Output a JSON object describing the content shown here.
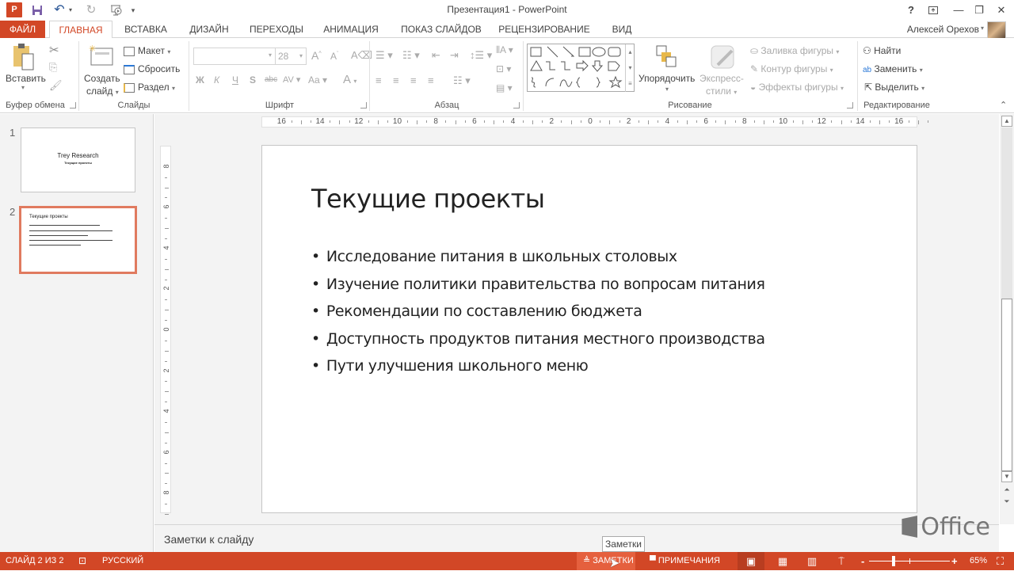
{
  "titlebar": {
    "app_logo": "P",
    "title": "Презентация1 - PowerPoint",
    "quick_access": [
      "save-icon",
      "undo-icon",
      "redo-icon",
      "start-slideshow-icon",
      "customize-qat-icon"
    ],
    "window_buttons": {
      "help": "?",
      "ribbon_display": "⊼",
      "minimize": "—",
      "restore": "❐",
      "close": "✕"
    }
  },
  "tabs": [
    {
      "label": "ФАЙЛ"
    },
    {
      "label": "ГЛАВНАЯ",
      "active": true
    },
    {
      "label": "ВСТАВКА"
    },
    {
      "label": "ДИЗАЙН"
    },
    {
      "label": "ПЕРЕХОДЫ"
    },
    {
      "label": "АНИМАЦИЯ"
    },
    {
      "label": "ПОКАЗ СЛАЙДОВ"
    },
    {
      "label": "РЕЦЕНЗИРОВАНИЕ"
    },
    {
      "label": "ВИД"
    }
  ],
  "user": {
    "name": "Алексей Орехов"
  },
  "ribbon": {
    "clipboard": {
      "label": "Буфер обмена",
      "paste": "Вставить"
    },
    "slides": {
      "label": "Слайды",
      "new_slide_1": "Создать",
      "new_slide_2": "слайд",
      "layout": "Макет",
      "reset": "Сбросить",
      "section": "Раздел"
    },
    "font": {
      "label": "Шрифт",
      "font_name": "",
      "font_size": "28",
      "bold": "Ж",
      "italic": "К",
      "underline": "Ч",
      "shadow": "S",
      "strike": "abc",
      "spacing": "AV",
      "case": "Aa",
      "color": "A"
    },
    "paragraph": {
      "label": "Абзац"
    },
    "drawing": {
      "label": "Рисование",
      "arrange": "Упорядочить",
      "quick_styles_1": "Экспресс-",
      "quick_styles_2": "стили",
      "shape_fill": "Заливка фигуры",
      "shape_outline": "Контур фигуры",
      "shape_effects": "Эффекты фигуры"
    },
    "editing": {
      "label": "Редактирование",
      "find": "Найти",
      "replace": "Заменить",
      "select": "Выделить"
    }
  },
  "thumbnails": [
    {
      "number": "1",
      "title": "Trey Research",
      "subtitle": "Текущие проекты"
    },
    {
      "number": "2",
      "title": "Текущие проекты",
      "selected": true
    }
  ],
  "rulers": {
    "horizontal": [
      "16",
      "14",
      "12",
      "10",
      "8",
      "6",
      "4",
      "2",
      "0",
      "2",
      "4",
      "6",
      "8",
      "10",
      "12",
      "14",
      "16"
    ],
    "vertical": [
      "8",
      "6",
      "4",
      "2",
      "0",
      "2",
      "4",
      "6",
      "8"
    ]
  },
  "slide": {
    "title": "Текущие проекты",
    "bullets": [
      "Исследование питания в школьных столовых",
      "Изучение политики правительства по вопросам питания",
      "Рекомендации по составлению бюджета",
      "Доступность продуктов питания местного производства",
      "Пути улучшения школьного меню"
    ]
  },
  "notes": {
    "placeholder": "Заметки к слайду"
  },
  "branding": {
    "office": "Office"
  },
  "tooltip": {
    "text": "Заметки"
  },
  "statusbar": {
    "slide_info": "СЛАЙД 2 ИЗ 2",
    "language": "РУССКИЙ",
    "notes": "ЗАМЕТКИ",
    "comments": "ПРИМЕЧАНИЯ",
    "zoom_percent": "65%",
    "zoom_level": 65,
    "color": "#d24726"
  },
  "colors": {
    "accent": "#d24726",
    "selection_border": "#e07a5f"
  }
}
